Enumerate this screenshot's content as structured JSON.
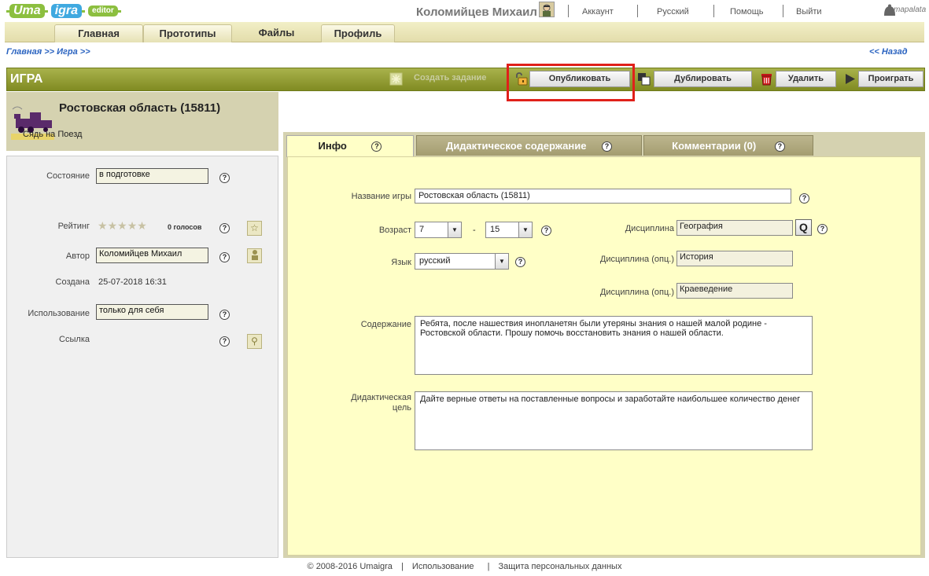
{
  "header": {
    "logo": {
      "part1": "Uma",
      "part2": "igra",
      "part3": "editor"
    },
    "username": "Коломийцев Михаил",
    "links": [
      "Аккаунт",
      "Русский",
      "Помощь",
      "Выйти"
    ],
    "brand": "mapalata"
  },
  "menu": [
    "Главная",
    "Прототипы",
    "Файлы",
    "Профиль"
  ],
  "breadcrumb": "Главная >> Игра >>",
  "back_label": "<< Назад",
  "toolbar": {
    "title": "ИГРА",
    "create_task": "Создать задание",
    "publish": "Опубликовать",
    "duplicate": "Дублировать",
    "delete": "Удалить",
    "play": "Проиграть"
  },
  "game": {
    "name": "Ростовская область (15811)",
    "subtitle": "Сядь на Поезд"
  },
  "left": {
    "status_label": "Состояние",
    "status_value": "в подготовке",
    "rating_label": "Рейтинг",
    "rating_votes": "0 голосов",
    "author_label": "Автор",
    "author_value": "Коломийцев Михаил",
    "created_label": "Создана",
    "created_value": "25-07-2018 16:31",
    "usage_label": "Использование",
    "usage_value": "только для себя",
    "link_label": "Ссылка"
  },
  "tabs": [
    "Инфо",
    "Дидактическое содержание",
    "Комментарии (0)"
  ],
  "form": {
    "name_label": "Название игры",
    "name_value": "Ростовская область (15811)",
    "age_label": "Возраст",
    "age_from": "7",
    "age_dash": "-",
    "age_to": "15",
    "lang_label": "Язык",
    "lang_value": "русский",
    "discipline_label": "Дисциплина",
    "discipline_value": "География",
    "discipline_opt_label": "Дисциплина (опц.)",
    "discipline_opt1": "История",
    "discipline_opt2": "Краеведение",
    "content_label": "Содержание",
    "content_value": "Ребята, после нашествия инопланетян были утеряны знания о нашей малой родине - Ростовской области. Прошу помочь восстановить знания о нашей области.",
    "goal_label": "Дидактическая цель",
    "goal_value": "Дайте верные ответы на поставленные вопросы и заработайте наибольшее количество денег"
  },
  "footer": {
    "copyright": "© 2008-2016 Umaigra",
    "usage": "Использование",
    "privacy": "Защита персональных данных"
  },
  "colors": {
    "accent": "#8cbf3f",
    "link": "#2a63c0",
    "highlight": "#e0201a",
    "content_bg": "#ffffc7"
  }
}
